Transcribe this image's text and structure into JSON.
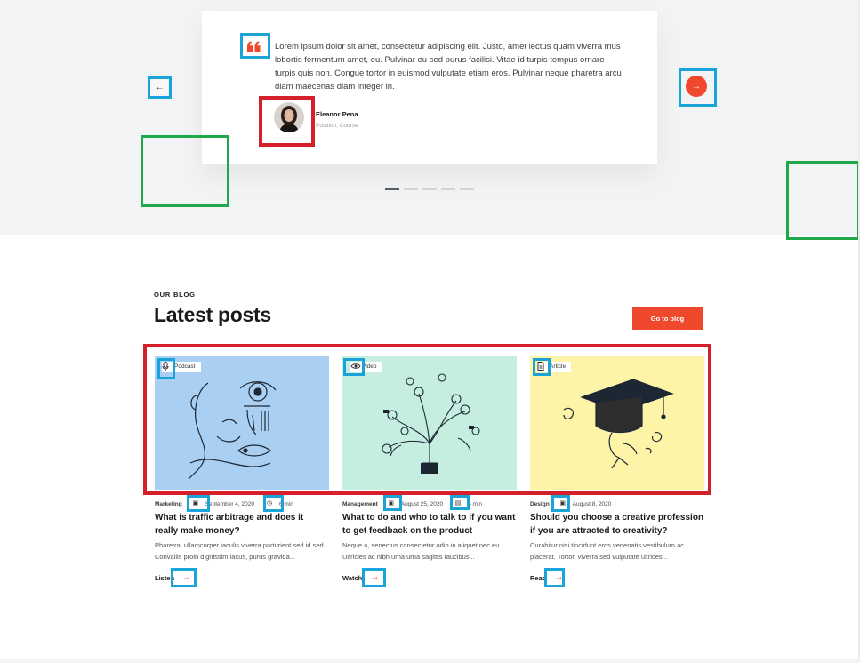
{
  "testimonial": {
    "quote": "Lorem ipsum dolor sit amet, consectetur adipiscing elit. Justo, amet lectus quam viverra mus lobortis fermentum amet, eu. Pulvinar eu sed purus facilisi. Vitae id turpis tempus ornare turpis quis non. Congue tortor in euismod vulputate etiam eros. Pulvinar neque pharetra arcu diam maecenas diam integer in.",
    "author_name": "Eleanor Pena",
    "author_role": "Position, Course",
    "prev_icon": "←",
    "next_icon": "→",
    "quote_icon": "quote-icon"
  },
  "blog": {
    "eyebrow": "OUR BLOG",
    "title": "Latest posts",
    "cta": "Go to blog",
    "posts": [
      {
        "type": "Podcast",
        "category": "Marketing",
        "date": "September 4, 2020",
        "duration": "6 min",
        "title": "What is traffic arbitrage and does it really make money?",
        "excerpt": "Pharetra, ullamcorper iaculis viverra parturient sed id sed. Convallis proin dignissim lacus, purus gravida...",
        "link": "Listen",
        "bg": "#a9cff3"
      },
      {
        "type": "Video",
        "category": "Management",
        "date": "August 25, 2020",
        "duration": "5 min",
        "title": "What to do and who to talk to if you want to get feedback on the product",
        "excerpt": "Neque a, senectus consectetur odio in aliquet nec eu. Ultricies ac nibh urna urna sagittis faucibus...",
        "link": "Watch",
        "bg": "#c5ede0"
      },
      {
        "type": "Article",
        "category": "Design",
        "date": "August 8, 2020",
        "title": "Should you choose a creative profession if you are attracted to creativity?",
        "excerpt": "Curabitur nisi tincidunt eros venenatis vestibulum ac placerat. Tortor, viverra sed vulputate ultrices...",
        "link": "Read",
        "bg": "#fdf4a8"
      }
    ]
  },
  "colors": {
    "accent": "#f0482d",
    "annotation_blue": "#1aa3d9",
    "annotation_red": "#d51f2a",
    "annotation_green": "#1ea84a"
  }
}
